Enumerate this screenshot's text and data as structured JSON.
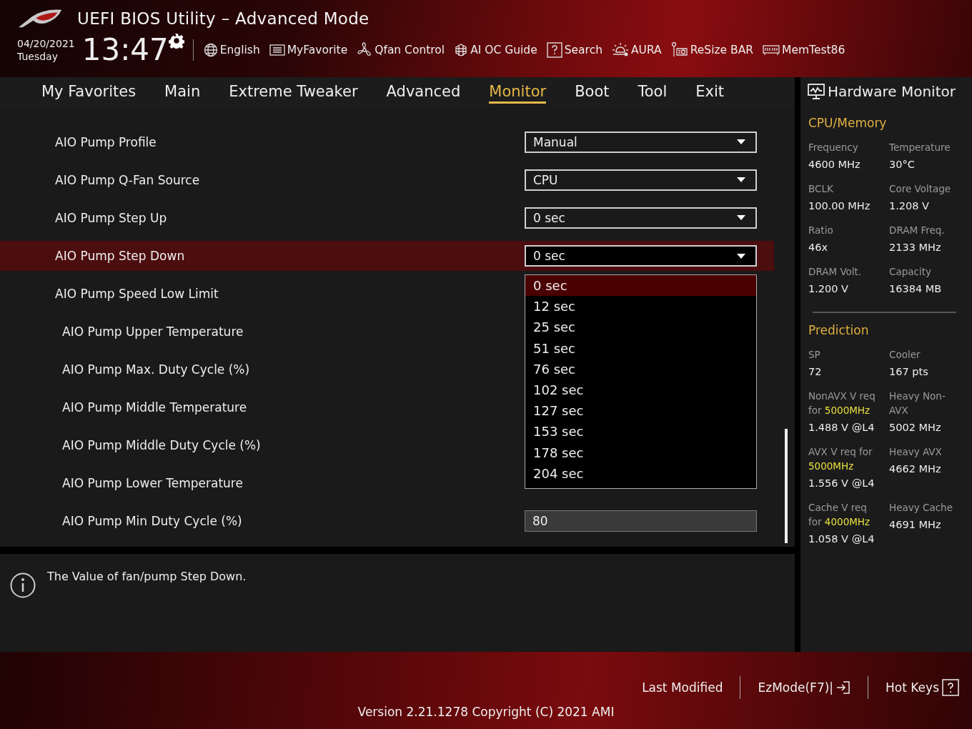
{
  "window": {
    "title": "UEFI BIOS Utility – Advanced Mode"
  },
  "clock": {
    "date": "04/20/2021",
    "day": "Tuesday",
    "time": "13:47"
  },
  "toolbar": [
    {
      "label": "English",
      "kind": "globe"
    },
    {
      "label": "MyFavorite",
      "kind": "favorite"
    },
    {
      "label": "Qfan Control",
      "kind": "fan"
    },
    {
      "label": "AI OC Guide",
      "kind": "chip"
    },
    {
      "label": "Search",
      "kind": "help"
    },
    {
      "label": "AURA",
      "kind": "light"
    },
    {
      "label": "ReSize BAR",
      "kind": "card"
    },
    {
      "label": "MemTest86",
      "kind": "memory"
    }
  ],
  "tabs": [
    {
      "label": "My Favorites",
      "selected": false
    },
    {
      "label": "Main",
      "selected": false
    },
    {
      "label": "Extreme Tweaker",
      "selected": false
    },
    {
      "label": "Advanced",
      "selected": false
    },
    {
      "label": "Monitor",
      "selected": true
    },
    {
      "label": "Boot",
      "selected": false
    },
    {
      "label": "Tool",
      "selected": false
    },
    {
      "label": "Exit",
      "selected": false
    }
  ],
  "settings": [
    {
      "label": "AIO Pump Profile",
      "kind": "dropdown",
      "value": "Manual",
      "selected": false
    },
    {
      "label": "AIO Pump Q-Fan Source",
      "kind": "dropdown",
      "value": "CPU",
      "selected": false
    },
    {
      "label": "AIO Pump Step Up",
      "kind": "dropdown",
      "value": "0 sec",
      "selected": false
    },
    {
      "label": "AIO Pump Step Down",
      "kind": "dropdown",
      "value": "0 sec",
      "selected": true
    },
    {
      "label": "AIO Pump Speed Low Limit",
      "kind": "hidden",
      "selected": false,
      "children": [
        {
          "label": "AIO Pump Upper Temperature",
          "kind": "hidden",
          "selected": false
        },
        {
          "label": "AIO Pump Max. Duty Cycle (%)",
          "kind": "hidden",
          "selected": false
        },
        {
          "label": "AIO Pump Middle Temperature",
          "kind": "hidden",
          "selected": false
        },
        {
          "label": "AIO Pump Middle Duty Cycle (%)",
          "kind": "hidden",
          "selected": false
        },
        {
          "label": "AIO Pump Lower Temperature",
          "kind": "hidden",
          "selected": false
        },
        {
          "label": "AIO Pump Min Duty Cycle (%)",
          "kind": "number",
          "value": "80",
          "selected": false
        }
      ]
    }
  ],
  "dropdown_list": [
    {
      "label": "0 sec",
      "selected": true
    },
    {
      "label": "12 sec",
      "selected": false
    },
    {
      "label": "25 sec",
      "selected": false
    },
    {
      "label": "51 sec",
      "selected": false
    },
    {
      "label": "76 sec",
      "selected": false
    },
    {
      "label": "102 sec",
      "selected": false
    },
    {
      "label": "127 sec",
      "selected": false
    },
    {
      "label": "153 sec",
      "selected": false
    },
    {
      "label": "178 sec",
      "selected": false
    },
    {
      "label": "204 sec",
      "selected": false
    }
  ],
  "help_text": "The Value of fan/pump Step Down.",
  "hardware_monitor": {
    "title": "Hardware Monitor",
    "sections": [
      {
        "title": "CPU/Memory",
        "items": [
          {
            "label": "Frequency",
            "value": "4600 MHz"
          },
          {
            "label": "Temperature",
            "value": "30°C"
          },
          {
            "label": "BCLK",
            "value": "100.00 MHz"
          },
          {
            "label": "Core Voltage",
            "value": "1.208 V"
          },
          {
            "label": "Ratio",
            "value": "46x"
          },
          {
            "label": "DRAM Freq.",
            "value": "2133 MHz"
          },
          {
            "label": "DRAM Volt.",
            "value": "1.200 V"
          },
          {
            "label": "Capacity",
            "value": "16384 MB"
          }
        ]
      },
      {
        "title": "Prediction",
        "items": [
          {
            "label": "SP",
            "value": "72"
          },
          {
            "label": "Cooler",
            "value": "167 pts"
          },
          {
            "label": "NonAVX V req for **5000MHz**",
            "value": "1.488 V @L4"
          },
          {
            "label": "Heavy Non-AVX",
            "value": "5002 MHz"
          },
          {
            "label": "AVX V req    for **5000MHz**",
            "value": "1.556 V @L4"
          },
          {
            "label": "Heavy AVX",
            "value": "4662 MHz"
          },
          {
            "label": "Cache V req for **4000MHz**",
            "value": "1.058 V @L4"
          },
          {
            "label": "Heavy Cache",
            "value": "4691 MHz"
          }
        ]
      }
    ]
  },
  "footer": {
    "actions": [
      {
        "label": "Last Modified",
        "kind": "plain"
      },
      {
        "label": "EzMode(F7)|",
        "kind": "exit"
      },
      {
        "label": "Hot Keys",
        "kind": "help"
      }
    ],
    "version": "Version 2.21.1278 Copyright (C) 2021 AMI"
  }
}
